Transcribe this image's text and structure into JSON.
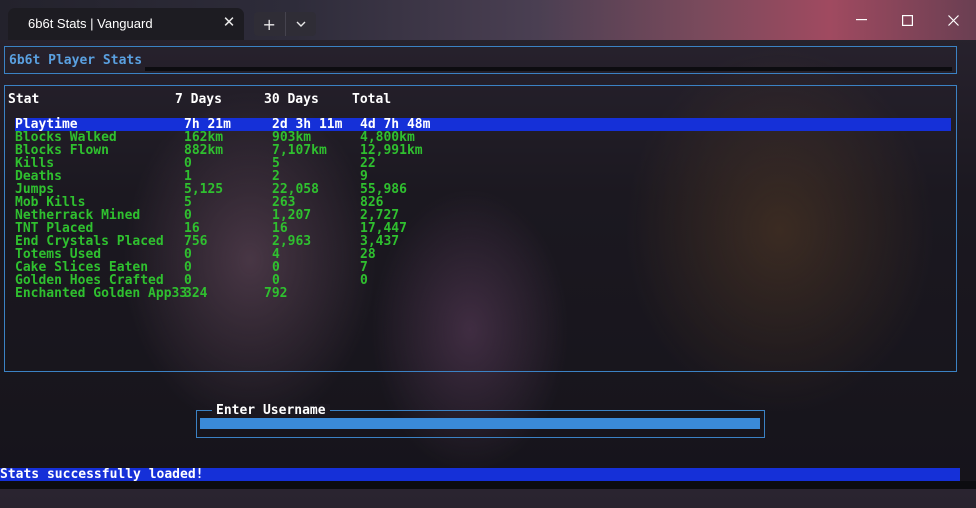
{
  "window": {
    "tab_title": "6b6t Stats | Vanguard",
    "tab_close_icon": "close-icon",
    "new_tab_icon": "plus-icon",
    "dropdown_icon": "chevron-down-icon",
    "minimize_icon": "minimize-icon",
    "maximize_icon": "maximize-icon",
    "close_icon": "close-icon"
  },
  "header": {
    "title": "6b6t Player Stats"
  },
  "stats": {
    "columns": [
      "Stat",
      "7 Days",
      "30 Days",
      "Total"
    ],
    "rows": [
      [
        "Playtime",
        "7h 21m",
        "2d 3h 11m",
        "4d 7h 48m"
      ],
      [
        "Blocks Walked",
        "162km",
        "903km",
        "4,800km"
      ],
      [
        "Blocks Flown",
        "882km",
        "7,107km",
        "12,991km"
      ],
      [
        "Kills",
        "0",
        "5",
        "22"
      ],
      [
        "Deaths",
        "1",
        "2",
        "9"
      ],
      [
        "Jumps",
        "5,125",
        "22,058",
        "55,986"
      ],
      [
        "Mob Kills",
        "5",
        "263",
        "826"
      ],
      [
        "Netherrack Mined",
        "0",
        "1,207",
        "2,727"
      ],
      [
        "TNT Placed",
        "16",
        "16",
        "17,447"
      ],
      [
        "End Crystals Placed",
        "756",
        "2,963",
        "3,437"
      ],
      [
        "Totems Used",
        "0",
        "4",
        "28"
      ],
      [
        "Cake Slices Eaten",
        "0",
        "0",
        "7"
      ],
      [
        "Golden Hoes Crafted",
        "0",
        "0",
        "0"
      ],
      [
        "Enchanted Golden App33",
        "324",
        "792",
        ""
      ]
    ],
    "selected_row": 0
  },
  "username": {
    "label": "Enter Username",
    "value": ""
  },
  "status": {
    "message": "Stats successfully loaded!"
  },
  "colors": {
    "accent_border": "#3b82c4",
    "selection": "#1530d8",
    "stat_text": "#2fc02f",
    "input_fill": "#3a8ad8"
  }
}
